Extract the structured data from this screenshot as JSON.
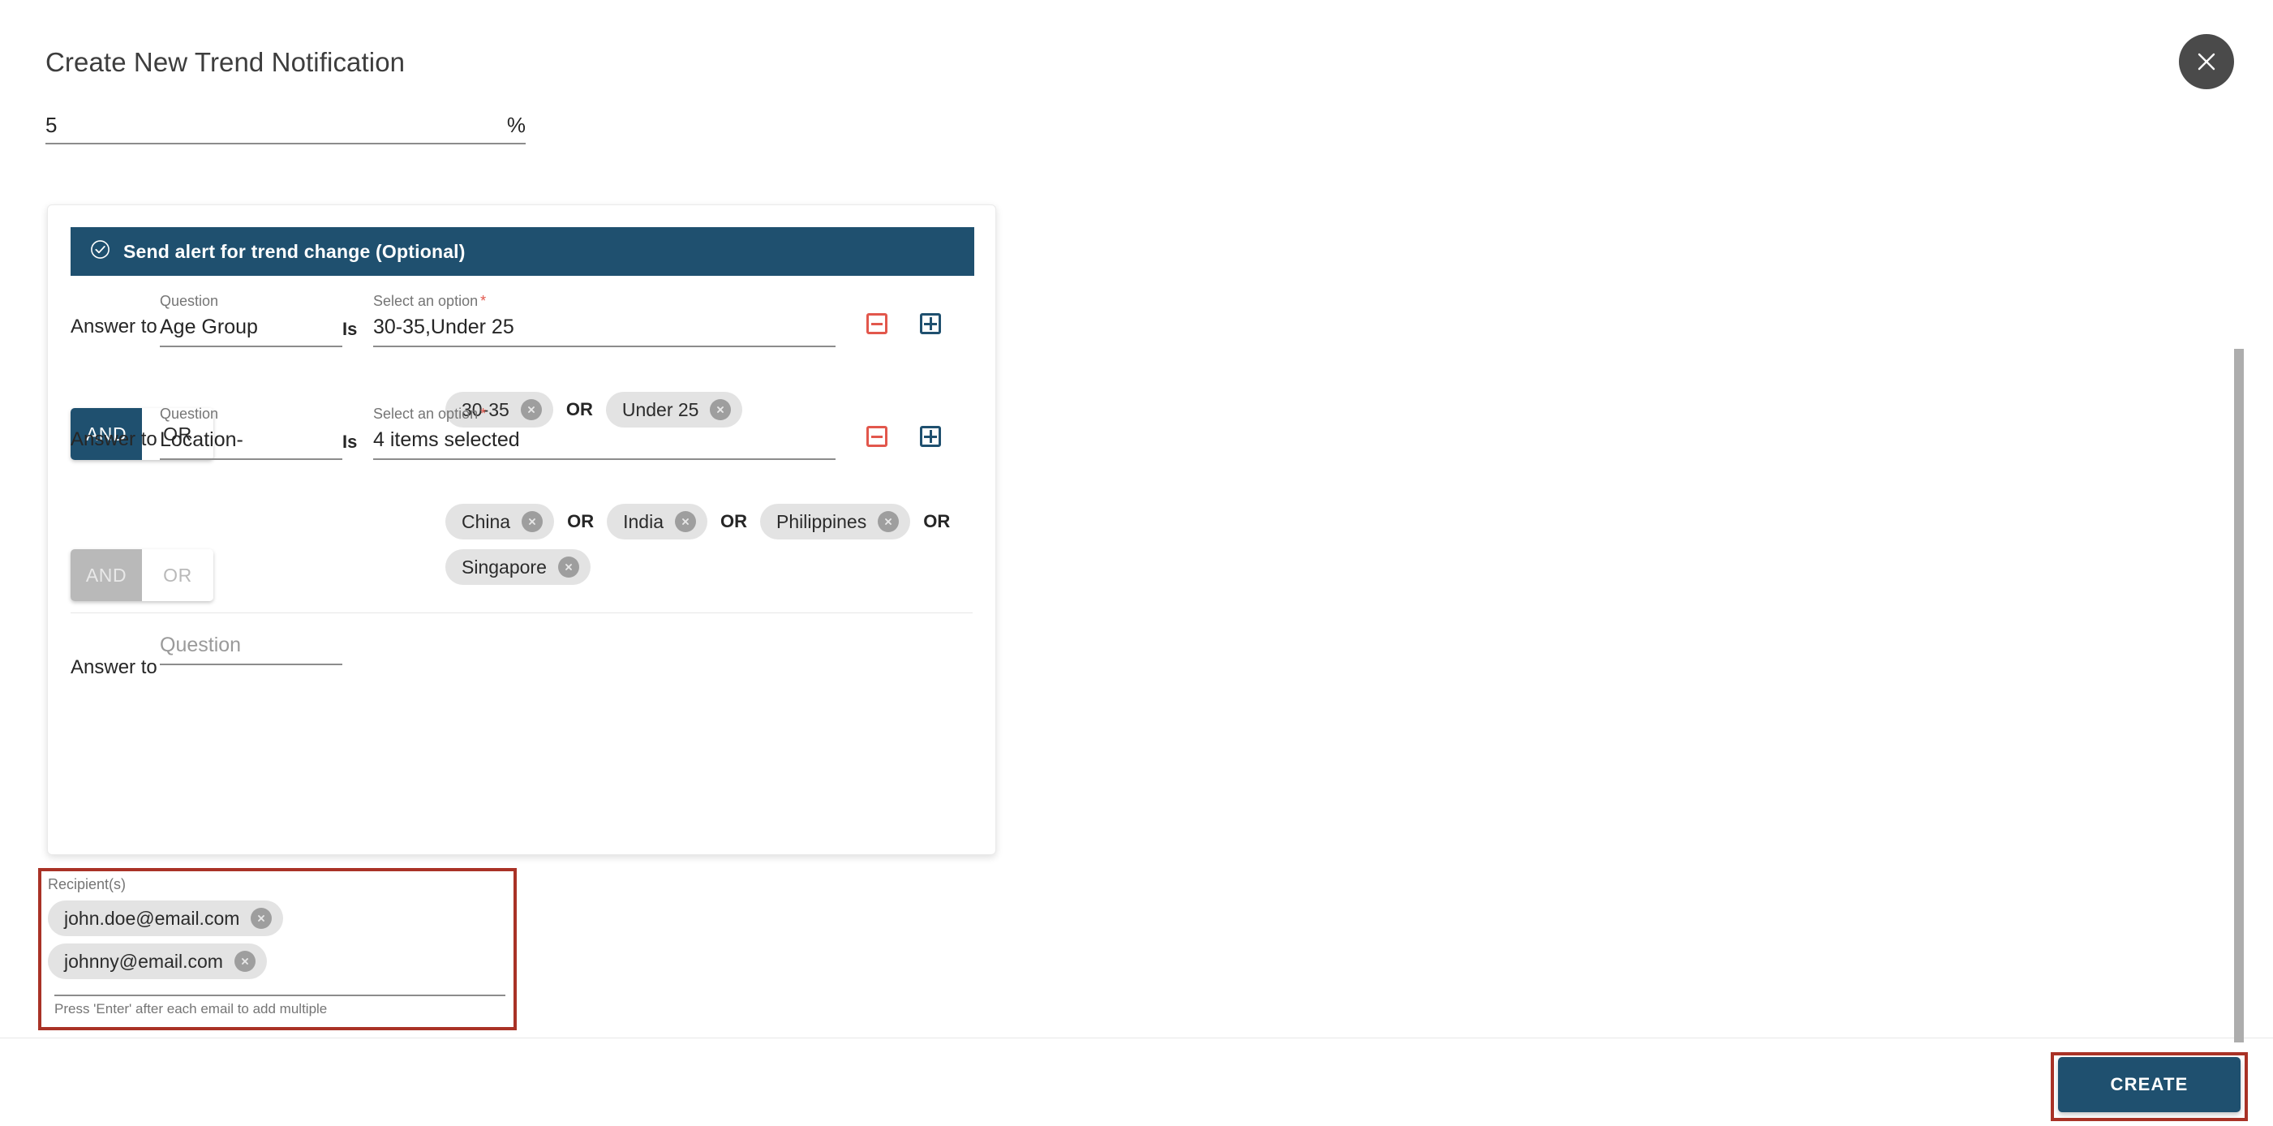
{
  "dialog": {
    "title": "Create New Trend Notification",
    "close_icon": "close-icon"
  },
  "threshold": {
    "value": "5",
    "unit": "%"
  },
  "alert_section": {
    "banner_label": "Send alert for trend change (Optional)",
    "banner_icon": "check-circle-icon",
    "banner_color": "#1f506f",
    "answer_to_label": "Answer to",
    "is_label": "Is",
    "question_label": "Question",
    "option_label": "Select an option",
    "required_marker": "*",
    "remove_icon": "minus-square-icon",
    "add_icon": "plus-square-icon",
    "remove_color": "#e2574c",
    "add_color": "#1f506f",
    "or_separator": "OR",
    "conditions": [
      {
        "question": "Age Group",
        "selection_summary": "30-35,Under 25",
        "chips": [
          "30-35",
          "Under 25"
        ],
        "has_actions": true
      },
      {
        "question": "Location-",
        "selection_summary": "4 items selected",
        "chips": [
          "China",
          "India",
          "Philippines",
          "Singapore"
        ],
        "has_actions": true
      },
      {
        "question": "",
        "question_placeholder": "Question",
        "selection_summary": "",
        "chips": [],
        "has_actions": false
      }
    ],
    "logic_toggles": [
      {
        "and_label": "AND",
        "or_label": "OR",
        "selected": "AND",
        "disabled": false
      },
      {
        "and_label": "AND",
        "or_label": "OR",
        "selected": "AND",
        "disabled": true
      }
    ]
  },
  "recipients": {
    "label": "Recipient(s)",
    "emails": [
      "john.doe@email.com",
      "johnny@email.com"
    ],
    "help_text": "Press 'Enter' after each email to add multiple",
    "highlight_color": "#a93226"
  },
  "footer": {
    "create_label": "CREATE",
    "create_color": "#1f506f",
    "highlight_color": "#a93226"
  }
}
